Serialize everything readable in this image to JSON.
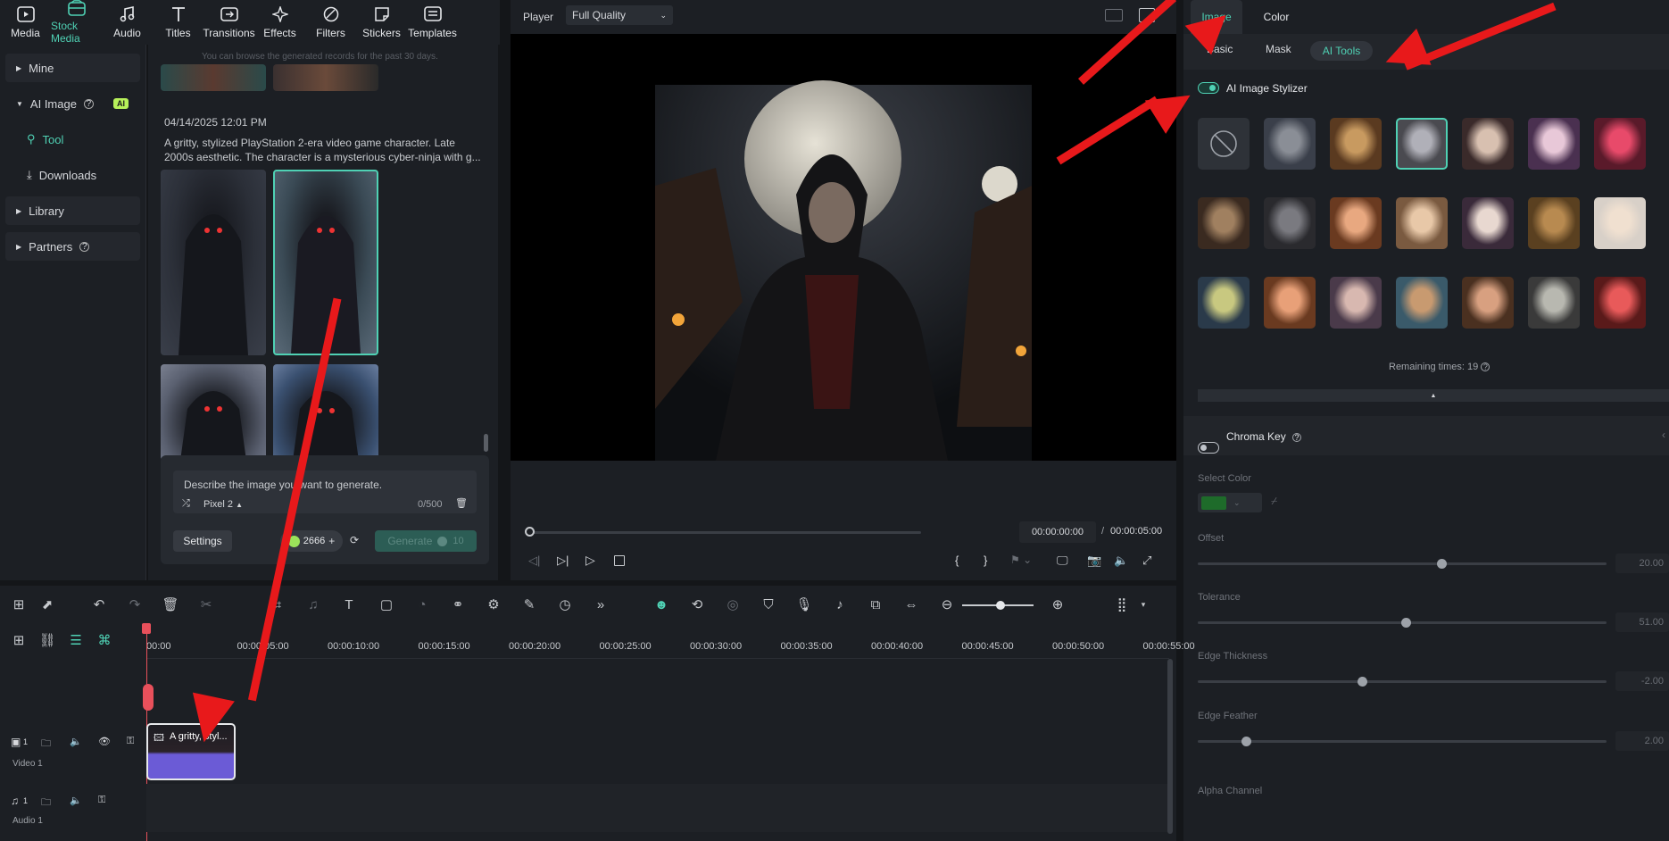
{
  "toolbar": {
    "items": [
      {
        "label": "Media",
        "icon": "media-icon"
      },
      {
        "label": "Stock Media",
        "icon": "stock-media-icon"
      },
      {
        "label": "Audio",
        "icon": "music-note-icon"
      },
      {
        "label": "Titles",
        "icon": "text-t-icon"
      },
      {
        "label": "Transitions",
        "icon": "transitions-icon"
      },
      {
        "label": "Effects",
        "icon": "sparkle-icon"
      },
      {
        "label": "Filters",
        "icon": "filters-icon"
      },
      {
        "label": "Stickers",
        "icon": "sticker-icon"
      },
      {
        "label": "Templates",
        "icon": "templates-icon"
      }
    ]
  },
  "leftnav": {
    "mine": "Mine",
    "ai_image": "AI Image",
    "ai_badge": "AI",
    "tool": "Tool",
    "downloads": "Downloads",
    "library": "Library",
    "partners": "Partners"
  },
  "gallery": {
    "notice": "You can browse the generated records for the past 30 days.",
    "date": "04/14/2025 12:01 PM",
    "prompt_line1": "A gritty, stylized PlayStation 2-era video game character. Late",
    "prompt_line2": "2000s aesthetic. The character is a mysterious cyber-ninja with g..."
  },
  "prompt": {
    "placeholder": "Describe the image you want to generate.",
    "style": "Pixel 2",
    "count": "0/500",
    "settings": "Settings",
    "credits": "2666",
    "generate": "Generate",
    "generate_cost": "10"
  },
  "player": {
    "label": "Player",
    "quality": "Full Quality",
    "current_time": "00:00:00:00",
    "separator": "/",
    "total_time": "00:00:05:00"
  },
  "right": {
    "tabs": [
      "Image",
      "Color"
    ],
    "subtabs": [
      "Basic",
      "Mask",
      "AI Tools"
    ],
    "stylizer": "AI Image Stylizer",
    "remaining": "Remaining times: 19",
    "chroma": "Chroma Key",
    "select_color": "Select Color",
    "chroma_color": "#1e6b2a",
    "offset": "Offset",
    "offset_val": "20.00",
    "offset_level": 0.6,
    "tolerance": "Tolerance",
    "tolerance_val": "51.00",
    "tolerance_level": 0.51,
    "edge_thickness": "Edge Thickness",
    "edge_thickness_val": "-2.00",
    "edge_thickness_level": 0.4,
    "edge_feather": "Edge Feather",
    "edge_feather_val": "2.00",
    "edge_feather_level": 0.11,
    "alpha": "Alpha Channel"
  },
  "timeline": {
    "ruler": [
      "00:00",
      "00:00:05:00",
      "00:00:10:00",
      "00:00:15:00",
      "00:00:20:00",
      "00:00:25:00",
      "00:00:30:00",
      "00:00:35:00",
      "00:00:40:00",
      "00:00:45:00",
      "00:00:50:00",
      "00:00:55:00"
    ],
    "clip_label": "A gritty, styl...",
    "video_track": "Video 1",
    "audio_track": "Audio 1",
    "video_num": "1",
    "audio_num": "1"
  },
  "colors": {
    "accent": "#4fd1b4",
    "annotation": "#e8191b",
    "clip": "#6b5bd6"
  }
}
